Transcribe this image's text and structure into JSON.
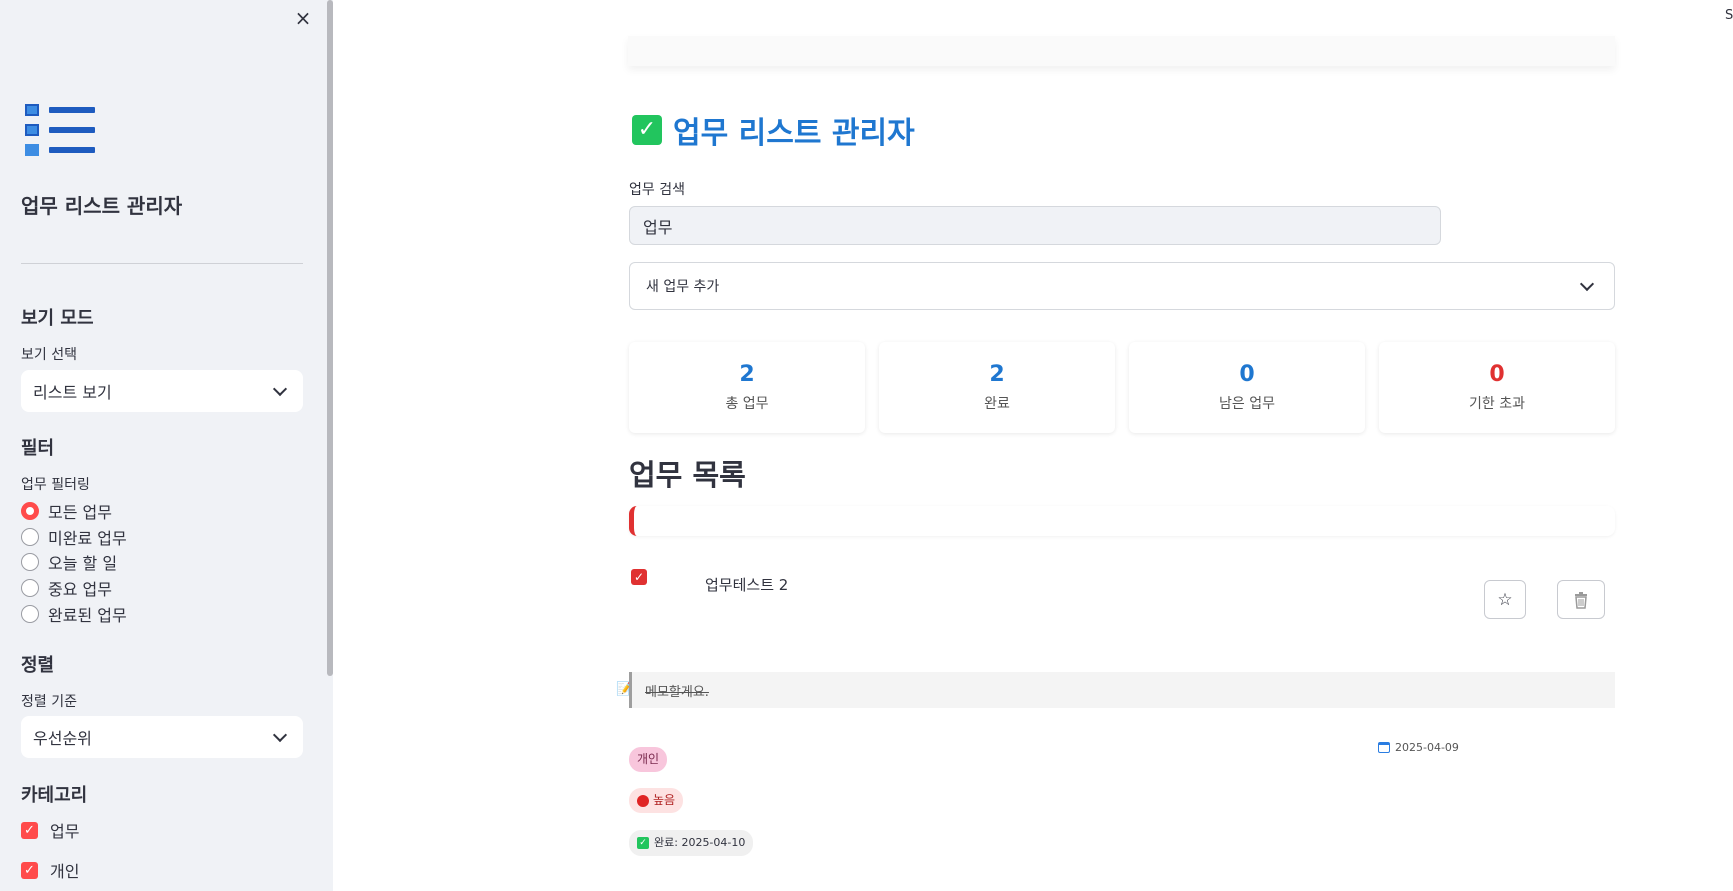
{
  "sidebar": {
    "close_icon": "×",
    "title": "업무 리스트 관리자",
    "view_mode": {
      "heading": "보기 모드",
      "label": "보기 선택",
      "selected": "리스트 보기"
    },
    "filter": {
      "heading": "필터",
      "label": "업무 필터링",
      "options": [
        "모든 업무",
        "미완료 업무",
        "오늘 할 일",
        "중요 업무",
        "완료된 업무"
      ],
      "selected_index": 0
    },
    "sort": {
      "heading": "정렬",
      "label": "정렬 기준",
      "selected": "우선순위"
    },
    "category": {
      "heading": "카테고리",
      "items": [
        {
          "label": "업무",
          "checked": true
        },
        {
          "label": "개인",
          "checked": true
        }
      ]
    }
  },
  "top_right_text": "S",
  "main": {
    "title": "업무 리스트 관리자",
    "search": {
      "label": "업무 검색",
      "value": "업무"
    },
    "add_task_expander": "새 업무 추가",
    "stats": [
      {
        "value": "2",
        "label": "총 업무"
      },
      {
        "value": "2",
        "label": "완료"
      },
      {
        "value": "0",
        "label": "남은 업무"
      },
      {
        "value": "0",
        "label": "기한 초과"
      }
    ],
    "list_heading": "업무 목록",
    "task": {
      "name": "업무테스트 2",
      "checked": true,
      "memo": "메모할게요.",
      "due_date": "2025-04-09",
      "category_tag": "개인",
      "priority_tag": "높음",
      "completed_tag": "완료: 2025-04-10"
    }
  },
  "colors": {
    "accent": "#ff4b4b",
    "title_blue": "#1f77d0",
    "overdue_red": "#e03131",
    "sidebar_bg": "#f0f2f6"
  },
  "icons": {
    "title": "check-square-icon",
    "favorite": "star-icon",
    "delete": "trash-icon",
    "memo": "memo-icon",
    "due_date": "calendar-icon"
  }
}
